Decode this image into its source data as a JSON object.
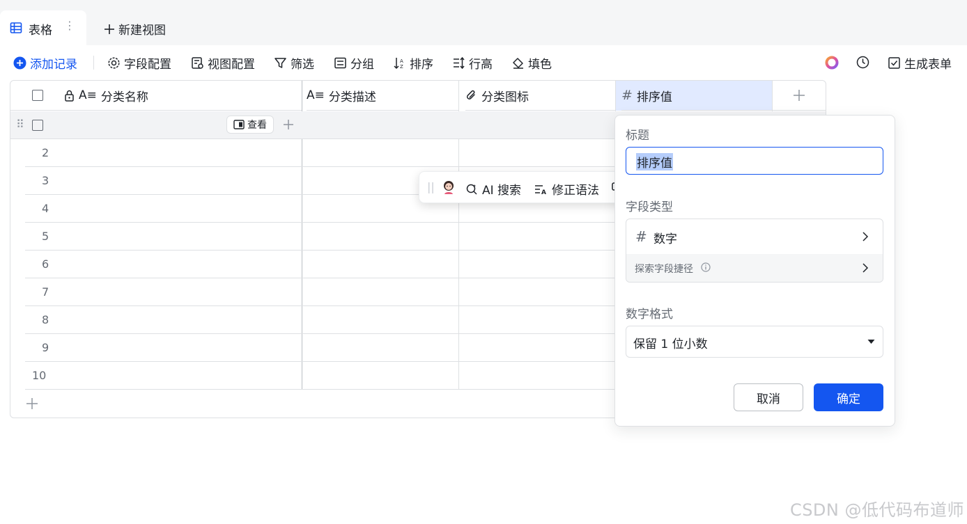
{
  "tabs": {
    "active_label": "表格",
    "new_view_label": "新建视图"
  },
  "toolbar": {
    "add_record": "添加记录",
    "field_config": "字段配置",
    "view_config": "视图配置",
    "filter": "筛选",
    "group": "分组",
    "sort": "排序",
    "row_height": "行高",
    "fill_color": "填色",
    "generate_form": "生成表单"
  },
  "table": {
    "columns": [
      {
        "label": "分类名称",
        "icon": "text-field-icon",
        "locked": true
      },
      {
        "label": "分类描述",
        "icon": "text-field-icon"
      },
      {
        "label": "分类图标",
        "icon": "attachment-icon"
      },
      {
        "label": "排序值",
        "icon": "number-hash-icon"
      }
    ],
    "view_button": "查看",
    "row_numbers": [
      "2",
      "3",
      "4",
      "5",
      "6",
      "7",
      "8",
      "9",
      "10"
    ]
  },
  "ai_toolbar": {
    "search": "AI 搜索",
    "grammar": "修正语法"
  },
  "field_panel": {
    "title_label": "标题",
    "title_value": "排序值",
    "type_label": "字段类型",
    "type_value": "数字",
    "explore_shortcut": "探索字段捷径",
    "format_label": "数字格式",
    "format_value": "保留 1 位小数",
    "cancel": "取消",
    "confirm": "确定"
  },
  "watermark": "CSDN @低代码布道师",
  "colors": {
    "accent": "#1456f0",
    "header_highlight": "#e1eaff",
    "border": "#dee0e3"
  }
}
